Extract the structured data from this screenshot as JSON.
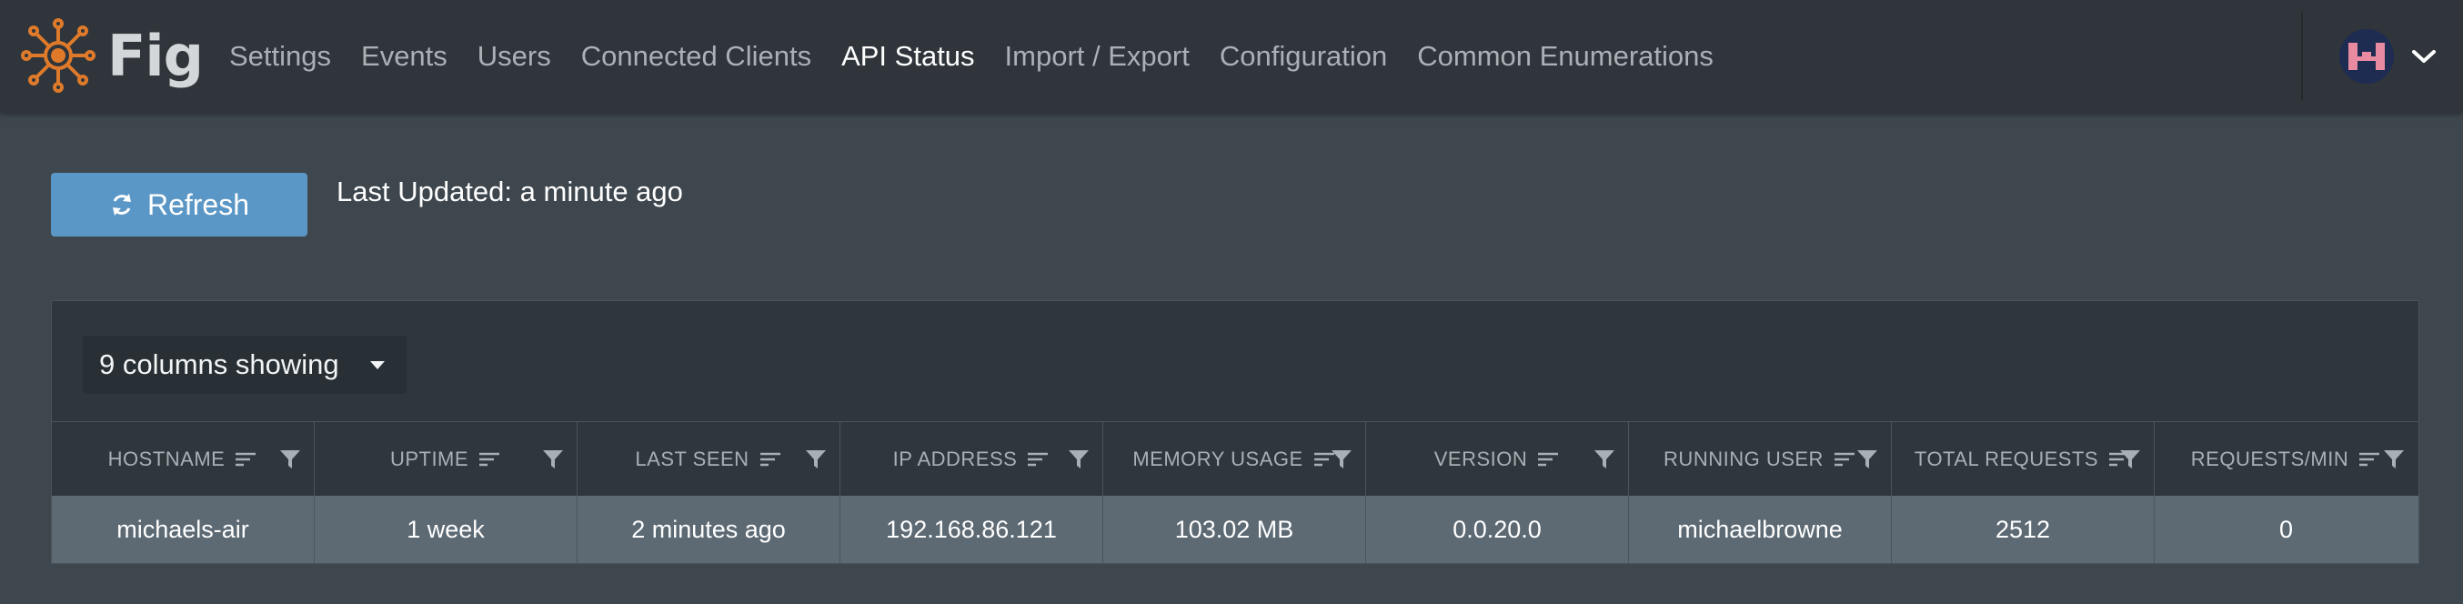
{
  "app": {
    "name": "Fig"
  },
  "nav": {
    "items": [
      {
        "label": "Settings",
        "active": false
      },
      {
        "label": "Events",
        "active": false
      },
      {
        "label": "Users",
        "active": false
      },
      {
        "label": "Connected Clients",
        "active": false
      },
      {
        "label": "API Status",
        "active": true
      },
      {
        "label": "Import / Export",
        "active": false
      },
      {
        "label": "Configuration",
        "active": false
      },
      {
        "label": "Common Enumerations",
        "active": false
      }
    ]
  },
  "toolbar": {
    "refresh_label": "Refresh",
    "last_updated_label": "Last Updated:",
    "last_updated_value": "a minute ago"
  },
  "table": {
    "columns_toggle_label": "9 columns showing",
    "columns": [
      "HOSTNAME",
      "UPTIME",
      "LAST SEEN",
      "IP ADDRESS",
      "MEMORY USAGE",
      "VERSION",
      "RUNNING USER",
      "TOTAL REQUESTS",
      "REQUESTS/MIN"
    ],
    "rows": [
      [
        "michaels-air",
        "1 week",
        "2 minutes ago",
        "192.168.86.121",
        "103.02 MB",
        "0.0.20.0",
        "michaelbrowne",
        "2512",
        "0"
      ]
    ]
  },
  "colors": {
    "accent": "#5b97c6",
    "logo": "#e07a2b",
    "topbar": "#2f353a",
    "page_bg": "#3e474e",
    "row_bg": "#5d6a74"
  },
  "icons": {
    "logo": "fig-logo-icon",
    "refresh": "refresh-icon",
    "sort": "sort-icon",
    "filter": "filter-icon",
    "dropdown": "caret-down-icon",
    "avatar": "avatar-icon",
    "user_menu": "chevron-down-icon"
  }
}
